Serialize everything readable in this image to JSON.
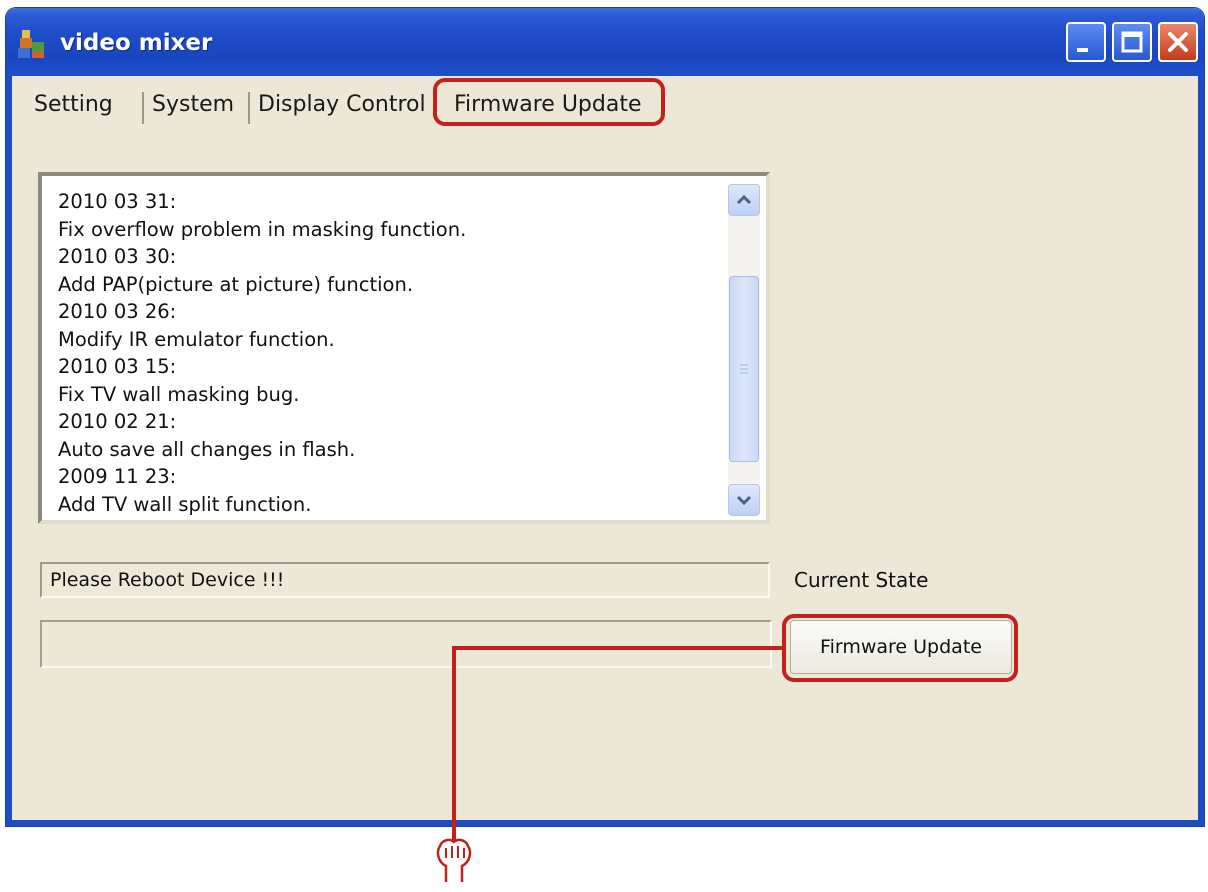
{
  "window": {
    "title": "video mixer"
  },
  "tabs": [
    {
      "label": "Setting"
    },
    {
      "label": "System"
    },
    {
      "label": "Display Control"
    },
    {
      "label": "Firmware Update",
      "active": true
    }
  ],
  "changelog": {
    "lines": [
      "2010 03 31:",
      "Fix overflow problem in masking function.",
      "2010 03 30:",
      "Add PAP(picture at picture) function.",
      "2010 03 26:",
      "Modify IR emulator function.",
      "2010 03 15:",
      "Fix TV wall masking bug.",
      "2010 02 21:",
      "Auto save all changes in flash.",
      "2009 11 23:",
      "Add TV wall split function."
    ]
  },
  "status": {
    "message": "Please Reboot Device !!!",
    "label": "Current State"
  },
  "actions": {
    "firmware_update_label": "Firmware Update"
  },
  "colors": {
    "titlebar": "#1f4cc7",
    "window_bg": "#ece7d6",
    "highlight": "#c5211c"
  },
  "icons": {
    "app": "video-mixer-app-icon",
    "minimize": "minimize-icon",
    "maximize": "maximize-icon",
    "close": "close-icon",
    "pointer": "pointing-hand-icon"
  }
}
